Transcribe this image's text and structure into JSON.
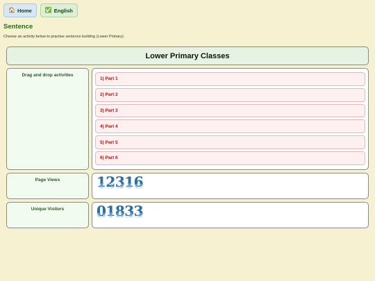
{
  "nav": {
    "home_label": "Home",
    "home_icon": "house-icon",
    "english_label": "English",
    "english_icon": "checkmark-icon"
  },
  "page": {
    "title": "Sentence",
    "description": "Choose an activity below to practise sentence building (Lower Primary)."
  },
  "section": {
    "title": "Lower Primary Classes"
  },
  "activities": {
    "label": "Drag and drop activities",
    "items": [
      "1) Part 1",
      "2) Part 2",
      "3) Part 3",
      "4) Part 4",
      "5) Part 5",
      "6) Part 6"
    ]
  },
  "stats": {
    "page_views_label": "Page Views",
    "page_views_value": "12316",
    "unique_visitors_label": "Unique Visitors",
    "unique_visitors_value": "01833"
  },
  "colors": {
    "background": "#f6f1d1",
    "title_green": "#2c6b1c",
    "part_red": "#a11a1a",
    "counter_blue": "#2b6fa3"
  }
}
